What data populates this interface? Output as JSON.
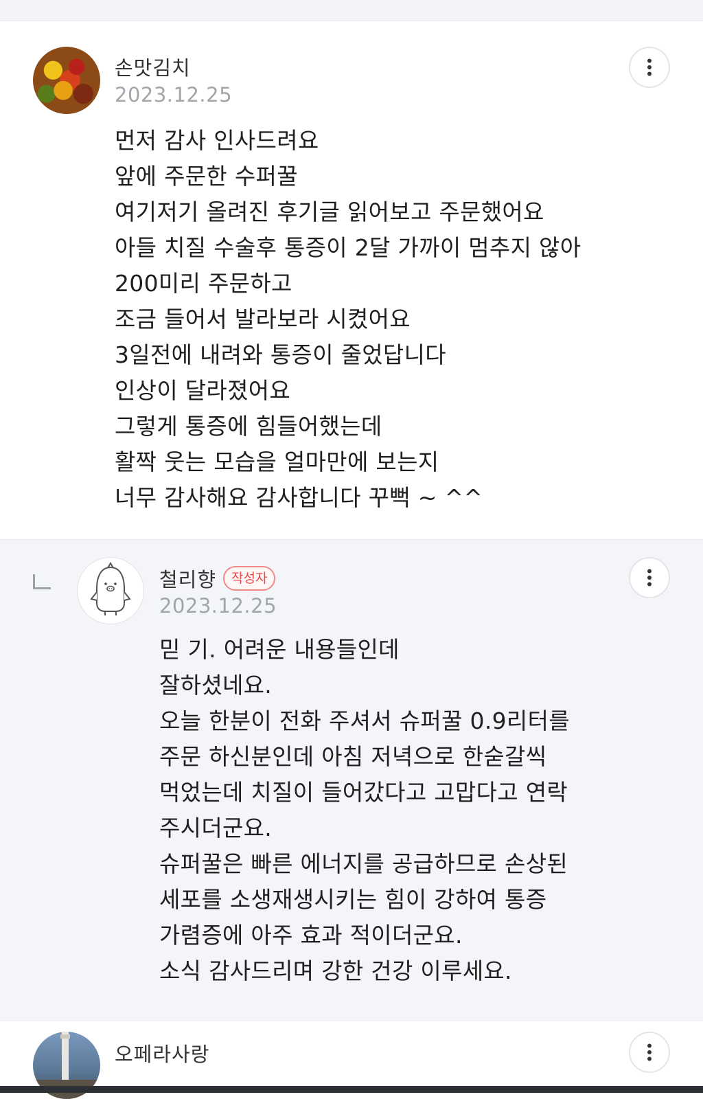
{
  "comments": [
    {
      "nickname": "손맛김치",
      "date": "2023.12.25",
      "avatar_icon": "user-avatar-photo",
      "body": "먼저 감사 인사드려요\n앞에 주문한 수퍼꿀\n여기저기 올려진 후기글 읽어보고 주문했어요\n아들 치질 수술후 통증이 2달 가까이 멈추지 않아\n200미리 주문하고\n조금 들어서 발라보라 시켰어요\n3일전에 내려와 통증이 줄었답니다\n인상이 달라졌어요\n그렇게 통증에 힘들어했는데\n활짝 웃는 모습을 얼마만에 보는지\n너무 감사해요 감사합니다 꾸뻑 ~ ^^"
    },
    {
      "nickname": "철리향",
      "badge": "작성자",
      "date": "2023.12.25",
      "avatar_icon": "default-penguin-avatar",
      "reply_icon": "reply-arrow-icon",
      "body": "믿 기. 어려운 내용들인데\n잘하셨네요.\n오늘 한분이 전화 주셔서 슈퍼꿀 0.9리터를\n주문 하신분인데 아침 저녁으로 한숟갈씩\n먹었는데 치질이 들어갔다고 고맙다고 연락\n주시더군요.\n슈퍼꿀은 빠른 에너지를 공급하므로 손상된\n세포를 소생재생시키는 힘이 강하여 통증\n가렴증에 아주 효과 적이더군요.\n소식 감사드리며 강한 건강 이루세요."
    },
    {
      "nickname": "오페라사랑",
      "avatar_icon": "user-avatar-photo"
    }
  ],
  "more_icon": "more-vertical-icon",
  "colors": {
    "badge": "#e5484d",
    "reply_background": "#f3f5f8",
    "date": "#a2a5a9"
  }
}
